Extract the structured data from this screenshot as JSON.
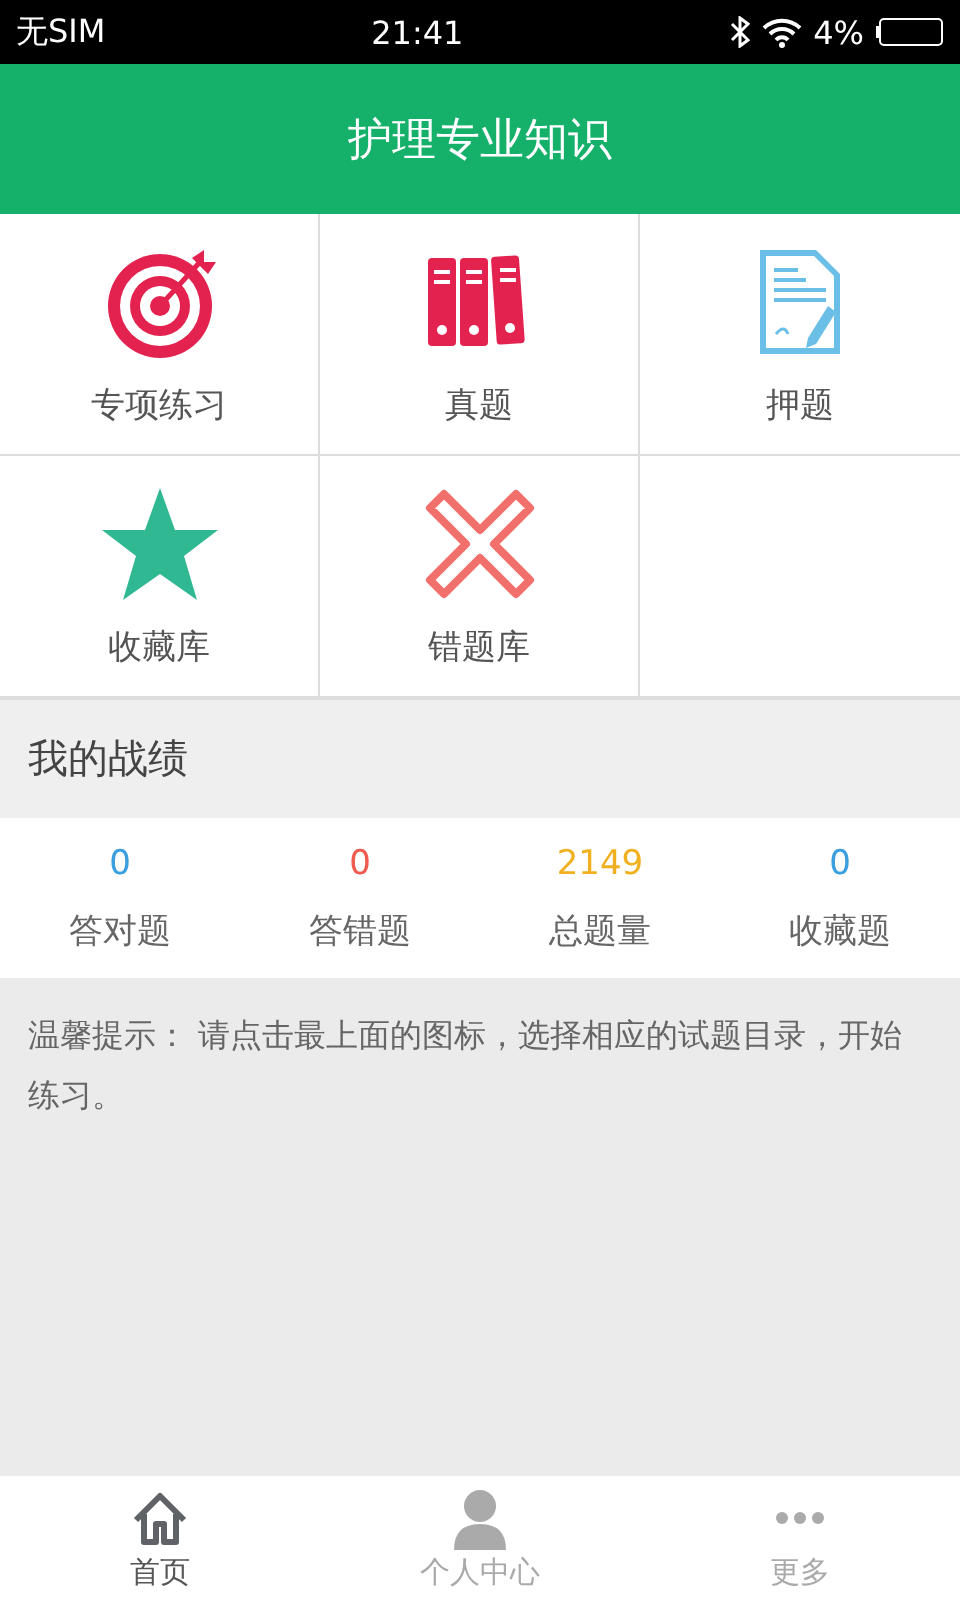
{
  "status_bar": {
    "carrier": "无SIM",
    "time": "21:41",
    "battery": "4%"
  },
  "header": {
    "title": "护理专业知识"
  },
  "tiles": [
    {
      "label": "专项练习",
      "kind": "target"
    },
    {
      "label": "真题",
      "kind": "binders"
    },
    {
      "label": "押题",
      "kind": "document"
    },
    {
      "label": "收藏库",
      "kind": "star"
    },
    {
      "label": "错题库",
      "kind": "cross"
    }
  ],
  "record": {
    "title": "我的战绩",
    "stats": [
      {
        "value": "0",
        "label": "答对题",
        "color": "#3a9fe0"
      },
      {
        "value": "0",
        "label": "答错题",
        "color": "#f05a4f"
      },
      {
        "value": "2149",
        "label": "总题量",
        "color": "#f0b020"
      },
      {
        "value": "0",
        "label": "收藏题",
        "color": "#3a9fe0"
      }
    ]
  },
  "tip": "温馨提示： 请点击最上面的图标，选择相应的试题目录，开始练习。",
  "tabs": [
    {
      "label": "首页",
      "kind": "home",
      "selected": true
    },
    {
      "label": "个人中心",
      "kind": "person",
      "selected": false
    },
    {
      "label": "更多",
      "kind": "more",
      "selected": false
    }
  ]
}
